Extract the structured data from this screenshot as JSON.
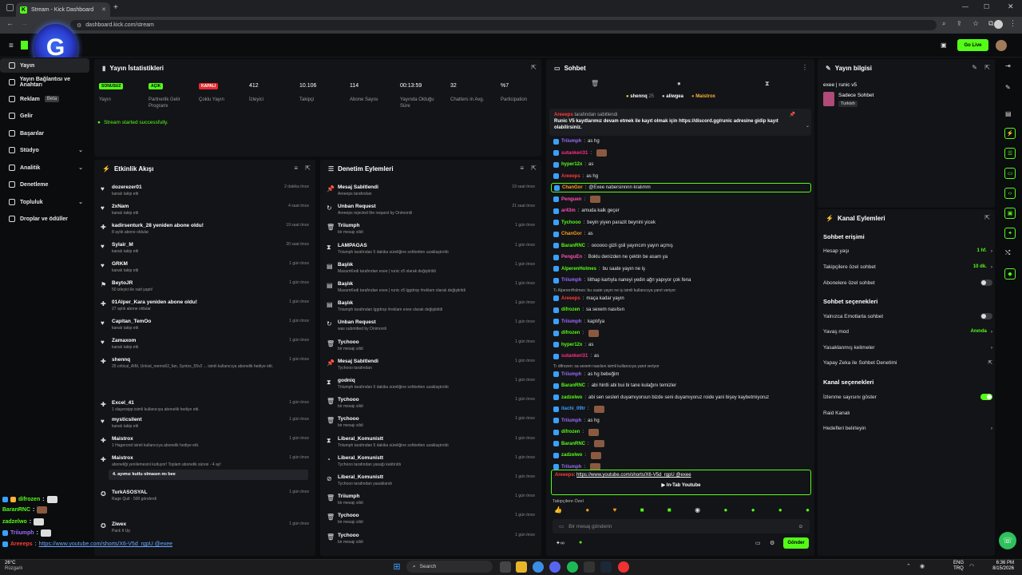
{
  "browser": {
    "tab_title": "Stream - Kick Dashboard",
    "new_tab": "+",
    "url": "dashboard.kick.com/stream"
  },
  "header": {
    "go_live": "Go Live",
    "logo_letter": "G"
  },
  "nav": {
    "items": [
      {
        "label": "Yayın",
        "active": true
      },
      {
        "label": "Yayın Bağlantısı ve Anahtarı"
      },
      {
        "label": "Reklam",
        "badge": "Beta"
      },
      {
        "label": "Gelir"
      },
      {
        "label": "Başarılar"
      },
      {
        "label": "Stüdyo",
        "chevron": "⌄"
      },
      {
        "label": "Analitik",
        "chevron": "⌄"
      },
      {
        "label": "Denetleme"
      },
      {
        "label": "Topluluk",
        "chevron": "⌄"
      },
      {
        "label": "Droplar ve ödüller"
      }
    ]
  },
  "stats": {
    "title": "Yayın İstatistikleri",
    "items": [
      {
        "value": "SONUSUZ",
        "label": "Yayın",
        "pill": "g"
      },
      {
        "value": "AÇIK",
        "label": "Partnerlik Gelir Programı",
        "pill": "g"
      },
      {
        "value": "KAPALI",
        "label": "Çoklu Yayın",
        "pill": "r"
      },
      {
        "value": "412",
        "label": "İzleyici"
      },
      {
        "value": "10.106",
        "label": "Takipçi"
      },
      {
        "value": "114",
        "label": "Abone Sayısı"
      },
      {
        "value": "00:13:59",
        "label": "Yayında Olduğu Süre"
      },
      {
        "value": "32",
        "label": "Chatters in Avg."
      },
      {
        "value": "%7",
        "label": "Participation"
      }
    ],
    "status": "Stream started successfully."
  },
  "activity": {
    "title": "Etkinlik Akışı",
    "rows": [
      {
        "name": "dozerezer01",
        "sub": "kanalı takip etti",
        "time": "2 dakika önce"
      },
      {
        "name": "2xNam",
        "sub": "kanalı takip etti",
        "time": "4 saat önce"
      },
      {
        "name": "kadirsenturk_28 yeniden abone oldu!",
        "sub": "8 aylık abone oldular",
        "time": "19 saat önce"
      },
      {
        "name": "Sylair_M",
        "sub": "kanalı takip etti",
        "time": "20 saat önce"
      },
      {
        "name": "GRKM",
        "sub": "kanalı takip etti",
        "time": "1 gün önce"
      },
      {
        "name": "BeytoJR",
        "sub": "50 izleyici ile raid yaptı!",
        "time": "1 gün önce"
      },
      {
        "name": "01Alper_Kara yeniden abone oldu!",
        "sub": "27 aylık abone oldular",
        "time": "1 gün önce"
      },
      {
        "name": "Capitan_TemOo",
        "sub": "kanalı takip etti",
        "time": "1 gün önce"
      },
      {
        "name": "Zamaxom",
        "sub": "kanalı takip etti",
        "time": "1 gün önce"
      },
      {
        "name": "shennq",
        "sub": "25 critical_AIM, Unlost_memo62_fan, Syntox_55v2 ... isimli kullanıcıya abonelik hediye etti.",
        "time": "1 gün önce"
      },
      {
        "name": "Excel_41",
        "sub": "1 slayersipp isimli kullanıcıya abonelik hediye etti.",
        "time": "1 gün önce"
      },
      {
        "name": "mysticsilent",
        "sub": "kanalı takip etti",
        "time": "1 gün önce"
      },
      {
        "name": "Maistrox",
        "sub": "1 Hagerond isimli kullanıcıya abonelik hediye etti.",
        "time": "1 gün önce"
      },
      {
        "name": "Maistrox",
        "sub": "aboneliği yenilemesini kutluyor! Toplam abonelik süresi - 4 ay!",
        "time": "1 gün önce"
      },
      {
        "name": "TurkASOSYAL",
        "sub": "Rage Quit · 500 gönderdi",
        "time": "1 gün önce"
      },
      {
        "name": "Ziwex",
        "sub": "Pack It Up",
        "time": "1 gün önce"
      }
    ],
    "quote": "4. ayımız kutlu olmasın mı bee"
  },
  "moderation": {
    "title": "Denetim Eylemleri",
    "rows": [
      {
        "name": "Mesaj Sabitlendi",
        "sub": "Areeeps tarafından",
        "time": "19 saat önce"
      },
      {
        "name": "Unban Request",
        "sub": "Areeeps rejected the request by Onimonili",
        "time": "21 saat önce"
      },
      {
        "name": "Triiumph",
        "sub": "bir mesajı sildi",
        "time": "1 gün önce"
      },
      {
        "name": "LAMPAGAS",
        "sub": "Triiumph tarafından 5 dakika süreliğine sohbetten uzaklaştırıldı",
        "time": "1 gün önce"
      },
      {
        "name": "Başlık",
        "sub": "MasumKedi tarafından exee | runic v5 olarak değiştirildi",
        "time": "1 gün önce"
      },
      {
        "name": "Başlık",
        "sub": "MasumKedi tarafından exee | runic v5 lggdrop #reklam olarak değiştirildi",
        "time": "1 gün önce"
      },
      {
        "name": "Başlık",
        "sub": "Triiumph tarafından lggdrop #reklam exee olarak değiştirildi",
        "time": "1 gün önce"
      },
      {
        "name": "Unban Request",
        "sub": "was submitted by Onimonili",
        "time": "1 gün önce"
      },
      {
        "name": "Tychooo",
        "sub": "bir mesajı sildi",
        "time": "1 gün önce"
      },
      {
        "name": "Mesaj Sabitlendi",
        "sub": "Tychooo tarafından",
        "time": "1 gün önce"
      },
      {
        "name": "godniq",
        "sub": "Triiumph tarafından 5 dakika süreliğine sohbetten uzaklaştırıldı",
        "time": "1 gün önce"
      },
      {
        "name": "Tychooo",
        "sub": "bir mesajı sildi",
        "time": "1 gün önce"
      },
      {
        "name": "Tychooo",
        "sub": "bir mesajı sildi",
        "time": "1 gün önce"
      },
      {
        "name": "Liberal_Komunistt",
        "sub": "Triiumph tarafından 5 dakika süreliğine sohbetten uzaklaştırıldı",
        "time": "1 gün önce"
      },
      {
        "name": "Liberal_Komunistt",
        "sub": "Tychooo tarafından yasağı kaldırıldı",
        "time": "1 gün önce"
      },
      {
        "name": "Liberal_Komunistt",
        "sub": "Tychooo tarafından yasaklandı",
        "time": "1 gün önce"
      },
      {
        "name": "Triiumph",
        "sub": "bir mesajı sildi",
        "time": "1 gün önce"
      },
      {
        "name": "Tychooo",
        "sub": "bir mesajı sildi",
        "time": "1 gün önce"
      },
      {
        "name": "Tychooo",
        "sub": "bir mesajı sildi",
        "time": "1 gün önce"
      }
    ]
  },
  "chat": {
    "title": "Sohbet",
    "top_users": [
      "shennq",
      "aliwgea",
      "Maistrox"
    ],
    "top_count": "25",
    "pinned": "Runic V5 kayıtlarımız devam etmek ile kayıt olmak için https://discord.gg/runic adresine gidip kayıt olabilirsiniz.",
    "pinned_by": "tarafından sabitlendi",
    "messages": [
      {
        "user": "Triiumph",
        "text": "as hg",
        "color": "#9b6bff"
      },
      {
        "user": "sutankeri31",
        "text": "",
        "color": "#ff2d8a",
        "hl": false
      },
      {
        "user": "hyper12x",
        "text": "as",
        "color": "#53fc18"
      },
      {
        "user": "Areeeps",
        "text": "as hg",
        "color": "#ff3b3b"
      },
      {
        "user": "ChanGor",
        "text": "@Exee nabersinnnn kralımm",
        "color": "#ff9a1a",
        "hl": true
      },
      {
        "user": "Penguen",
        "text": "",
        "color": "#ff4fb4"
      },
      {
        "user": "ar43m",
        "text": "amuda kalk geçer",
        "color": "#ff4fb4"
      },
      {
        "user": "Tychooo",
        "text": "beyin yiyen parazit beynini yicek",
        "color": "#53fc18"
      },
      {
        "user": "ChanGor",
        "text": "as",
        "color": "#ff9a1a"
      },
      {
        "user": "BaranRNC",
        "text": "oooooo gizli gsli yayıncım yayın açmış",
        "color": "#53fc18"
      },
      {
        "user": "PenguEn",
        "text": "Boklu denizden ne çektin be asam ya",
        "color": "#ff4fb4"
      },
      {
        "user": "AlperenHolmes",
        "text": "bu saate yayın ne iş",
        "color": "#53fc18"
      },
      {
        "user": "Triiumph",
        "text": "liithap kartıyla naneyi yedin ağn yapıyor çok fena",
        "color": "#9b6bff"
      },
      {
        "user": "Areeeps",
        "text": "maça kadar yayın",
        "color": "#ff3b3b",
        "reply": "Tı AlperenHolmes: bu saate yayın ne iş isimli kullanıcıya yanıt veriyor"
      },
      {
        "user": "difrozen",
        "text": "sa sexem nasılsın",
        "color": "#53fc18"
      },
      {
        "user": "Triiumph",
        "text": "kaptıfya",
        "color": "#9b6bff"
      },
      {
        "user": "difrozen",
        "text": "",
        "color": "#53fc18"
      },
      {
        "user": "hyper12x",
        "text": "as",
        "color": "#53fc18"
      },
      {
        "user": "sutankeri31",
        "text": "as",
        "color": "#ff2d8a"
      },
      {
        "user": "Triiumph",
        "text": "as hg bebeğim",
        "color": "#9b6bff",
        "reply": "Tı difrozen: sa sexem nasılsın isimli kullanıcıya yanıt veriyor"
      },
      {
        "user": "BaranRNC",
        "text": "abi hintli abi bui bi tane kulağını temizler",
        "color": "#53fc18"
      },
      {
        "user": "zadzelwo",
        "text": "abi sen sesleri duyamıyorsun bizde seni duyamıyoruz roide yani bişey kaybetmiyoruz",
        "color": "#53fc18"
      },
      {
        "user": "itachi_09tr",
        "text": "",
        "color": "#3aa0ff"
      },
      {
        "user": "Triiumph",
        "text": "as hg",
        "color": "#9b6bff"
      },
      {
        "user": "difrozen",
        "text": "",
        "color": "#53fc18"
      },
      {
        "user": "BaranRNC",
        "text": "",
        "color": "#53fc18"
      },
      {
        "user": "zadzelwo",
        "text": "",
        "color": "#53fc18"
      },
      {
        "user": "Triiumph",
        "text": "",
        "color": "#9b6bff"
      }
    ],
    "last_user": "Areeeps",
    "last_link": "https://www.youtube.com/shorts/X6-V5d_rgpU @exee",
    "in_tab": "In-Tab Youtube",
    "followers_only": "Takipçilere Özel",
    "placeholder": "Bir mesaj gönderin",
    "send": "Gönder"
  },
  "stream_info": {
    "title": "Yayın bilgisi",
    "stream_title": "exee | runic v5",
    "chat_mode": "Sadece Sohbet",
    "language": "Turkish"
  },
  "channel_actions": {
    "title": "Kanal Eylemleri",
    "chat_access": "Sohbet erişimi",
    "account_age": {
      "label": "Hesap yaşı",
      "value": "1 hf."
    },
    "followers_chat": {
      "label": "Takipçilere özel sohbet",
      "value": "10 dk."
    },
    "subs_chat": {
      "label": "Abonelere özel sohbet"
    },
    "chat_options": "Sohbet seçenekleri",
    "emotes_only": {
      "label": "Yalnızca Emotlarla sohbet"
    },
    "slow_mode": {
      "label": "Yavaş mod",
      "value": "Anında"
    },
    "banned_words": {
      "label": "Yasaklanmış kelimeler"
    },
    "ai_mod": {
      "label": "Yapay Zeka ile Sohbet Denetimi"
    },
    "channel_options": "Kanal seçenekleri",
    "show_viewers": {
      "label": "İzlenme sayısını göster"
    },
    "raid_channel": {
      "label": "Raid Kanalı"
    },
    "set_goals": {
      "label": "Hedefleri belirleyin"
    }
  },
  "overlay_chat": [
    {
      "user": "difrozen",
      "color": "#53fc18"
    },
    {
      "user": "BaranRNC",
      "color": "#53fc18"
    },
    {
      "user": "zadzelwo",
      "color": "#53fc18"
    },
    {
      "user": "Triiumph",
      "color": "#9b6bff"
    },
    {
      "user": "Areeeps",
      "color": "#ff3b3b",
      "text": "https://www.youtube.com/shorts/X6-V5d_rgpU @exee"
    }
  ],
  "taskbar": {
    "weather_temp": "26°C",
    "weather_desc": "Rüzgarlı",
    "search": "Search",
    "lang": "ENG",
    "lang2": "TRQ",
    "time": "6:36 PM",
    "date": "8/15/2026"
  },
  "colors": {
    "accent": "#53fc18",
    "red": "#e6292f"
  }
}
